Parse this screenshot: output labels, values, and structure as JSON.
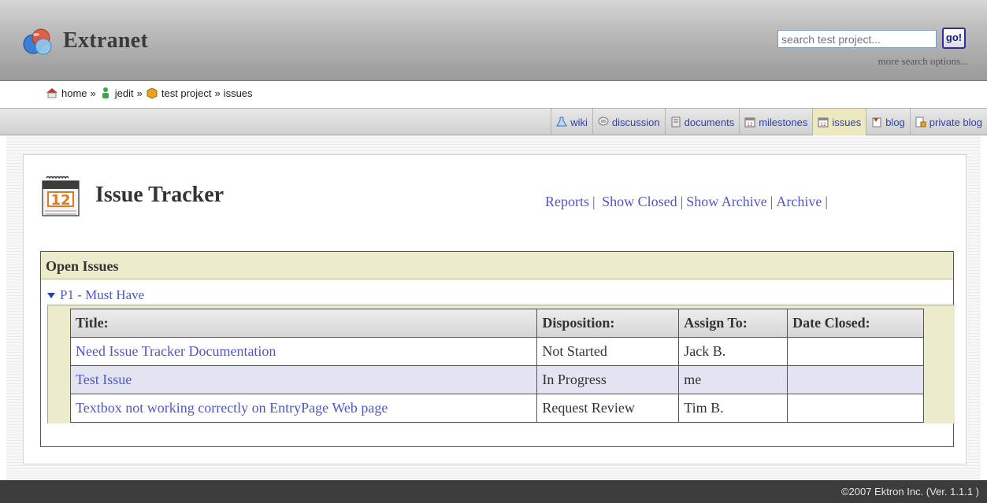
{
  "header": {
    "brand": "Extranet",
    "search": {
      "placeholder": "search test project...",
      "value": "search test project..."
    },
    "go_label": "go!",
    "more_search": "more search options..."
  },
  "breadcrumb": {
    "items": [
      {
        "label": "home",
        "icon": "home-icon"
      },
      {
        "label": "jedit",
        "icon": "user-icon"
      },
      {
        "label": "test project",
        "icon": "box-icon"
      },
      {
        "label": "issues",
        "icon": ""
      }
    ],
    "separator": "»"
  },
  "nav": {
    "tabs": [
      {
        "label": "wiki",
        "icon": "flask-icon",
        "active": false
      },
      {
        "label": "discussion",
        "icon": "speech-bubble-icon",
        "active": false
      },
      {
        "label": "documents",
        "icon": "document-icon",
        "active": false
      },
      {
        "label": "milestones",
        "icon": "calendar-icon",
        "active": false
      },
      {
        "label": "issues",
        "icon": "calendar-icon",
        "active": true
      },
      {
        "label": "blog",
        "icon": "blog-icon",
        "active": false
      },
      {
        "label": "private blog",
        "icon": "locked-document-icon",
        "active": false
      }
    ]
  },
  "main": {
    "calendar_number": "12",
    "title": "Issue Tracker",
    "actions": [
      "Reports",
      "Show Closed",
      "Show Archive",
      "Archive"
    ],
    "action_sep": "|",
    "issues_header": "Open Issues",
    "group": "P1 - Must Have",
    "columns": [
      "Title:",
      "Disposition:",
      "Assign To:",
      "Date Closed:"
    ],
    "rows": [
      [
        "Need Issue Tracker Documentation",
        "Not Started",
        "Jack B.",
        ""
      ],
      [
        "Test Issue",
        "In Progress",
        "me",
        ""
      ],
      [
        "Textbox not working correctly on EntryPage Web page",
        "Request Review",
        "Tim B.",
        ""
      ]
    ]
  },
  "footer": {
    "copyright": "©2007 Ektron Inc. (Ver. 1.1.1 )"
  },
  "colors": {
    "link": "#4f56c8",
    "nav_link": "#2a3fb5",
    "active_tab": "#ece9c0",
    "footer": "#3c3c3c"
  }
}
